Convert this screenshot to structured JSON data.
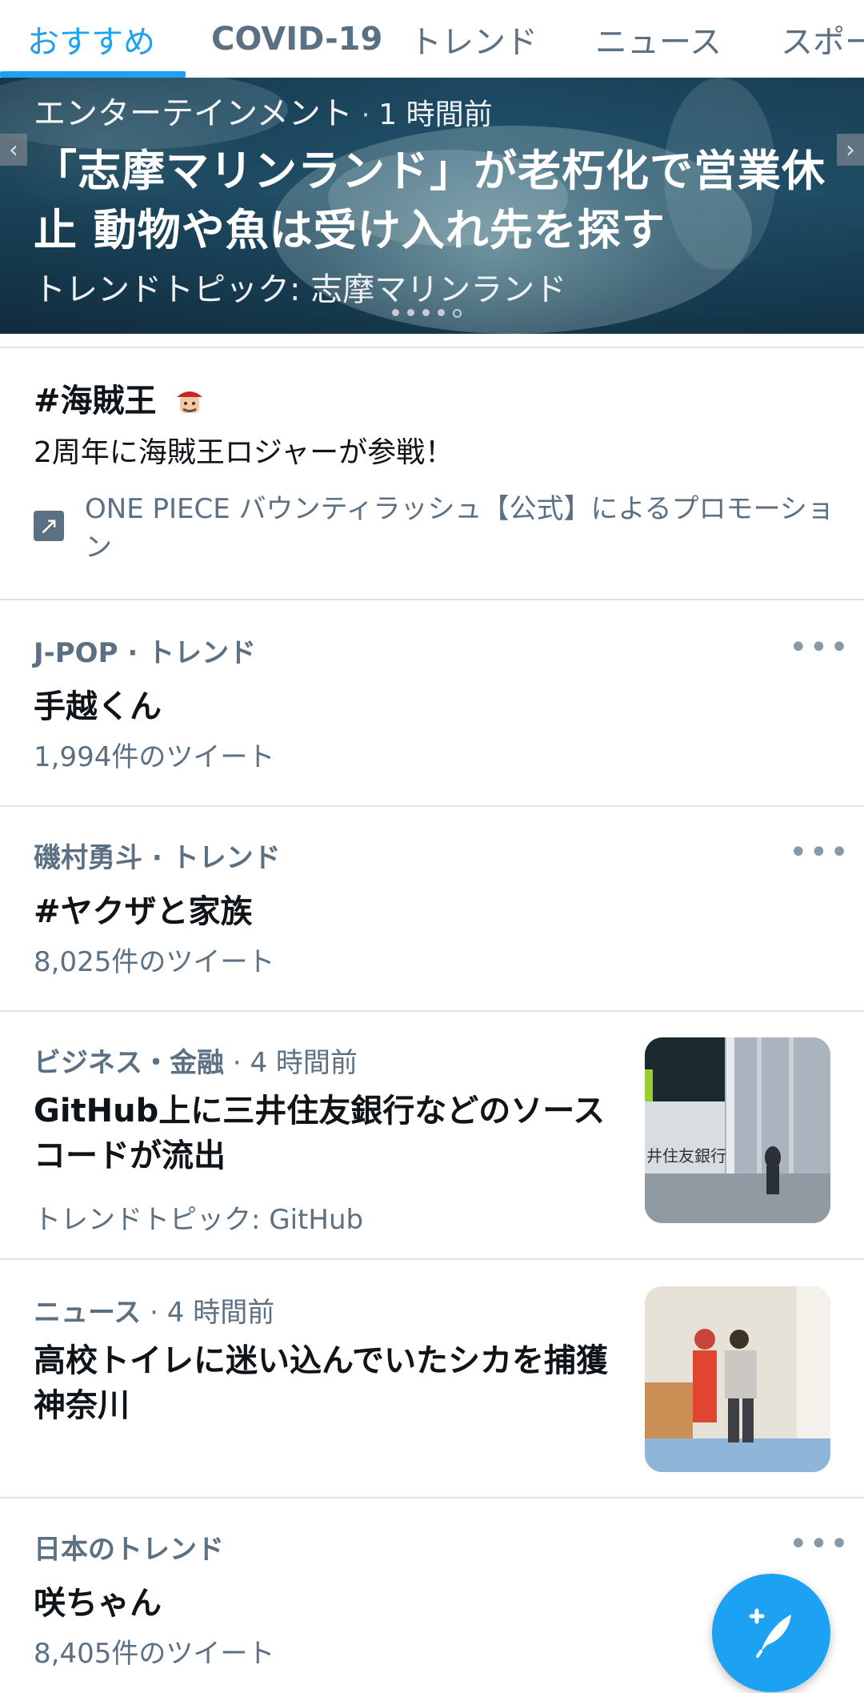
{
  "tabs": [
    {
      "label": "おすすめ"
    },
    {
      "label": "COVID-19"
    },
    {
      "label": "トレンド"
    },
    {
      "label": "ニュース"
    },
    {
      "label": "スポー"
    }
  ],
  "hero": {
    "category": "エンターテインメント",
    "time": "1 時間前",
    "title": "「志摩マリンランド」が老朽化で営業休止 動物や魚は受け入れ先を探す",
    "subtitle": "トレンドトピック: 志摩マリンランド",
    "slide_count": 5,
    "active_slide": 5
  },
  "promo": {
    "title": "#海賊王",
    "description": "2周年に海賊王ロジャーが参戦！",
    "promoted_by": "ONE PIECE バウンティラッシュ【公式】によるプロモーション",
    "icon": "promoted-arrow-icon"
  },
  "trends": [
    {
      "category": "J-POP · トレンド",
      "title": "手越くん",
      "count": "1,994件のツイート",
      "more": "•••"
    },
    {
      "category": "磯村勇斗 · トレンド",
      "title": "#ヤクザと家族",
      "count": "8,025件のツイート",
      "more": "•••"
    }
  ],
  "news": [
    {
      "category": "ビジネス・金融",
      "time": "4 時間前",
      "title": "GitHub上に三井住友銀行などのソースコードが流出",
      "topic": "トレンドトピック: GitHub",
      "thumb_text": "井住友銀行"
    },
    {
      "category": "ニュース",
      "time": "4 時間前",
      "title": "高校トイレに迷い込んでいたシカを捕獲 神奈川"
    }
  ],
  "japan_trend": {
    "category": "日本のトレンド",
    "title": "咲ちゃん",
    "count": "8,405件のツイート",
    "more": "•••"
  },
  "compose_button": {
    "icon": "compose-tweet-icon"
  },
  "colors": {
    "accent": "#1da1f2",
    "secondary_text": "#5b7083",
    "divider": "#dde3e7"
  }
}
